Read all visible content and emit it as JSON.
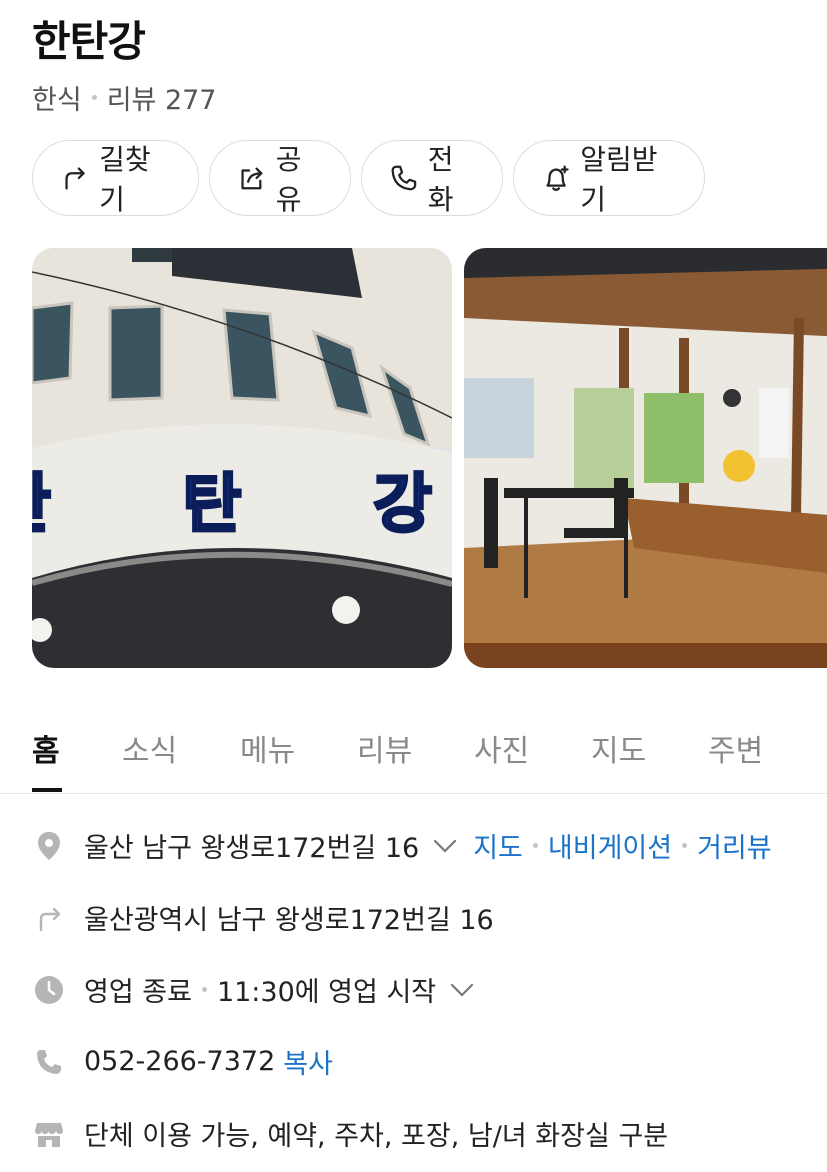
{
  "place": {
    "name": "한탄강",
    "category": "한식",
    "review_label": "리뷰 277"
  },
  "actions": {
    "route_label": "길찾기",
    "share_label": "공유",
    "call_label": "전화",
    "alarm_label": "알림받기"
  },
  "photos": {
    "sign_text": "한탄강"
  },
  "tabs": {
    "home": "홈",
    "news": "소식",
    "menu": "메뉴",
    "review": "리뷰",
    "photo": "사진",
    "map": "지도",
    "nearby": "주변"
  },
  "info": {
    "address": "울산 남구 왕생로172번길 16",
    "map_link": "지도",
    "navi_link": "내비게이션",
    "street_link": "거리뷰",
    "road_address": "울산광역시 남구 왕생로172번길 16",
    "status": "영업 종료",
    "hours": "11:30에 영업 시작",
    "phone": "052-266-7372",
    "copy_link": "복사",
    "amenities": "단체 이용 가능, 예약, 주차, 포장, 남/녀 화장실 구분"
  },
  "colors": {
    "link": "#1a73c9",
    "icon_gray": "#b5b5b5"
  },
  "icons": [
    "route-icon",
    "share-icon",
    "phone-icon",
    "bell-icon",
    "pin-icon",
    "road-arrow-icon",
    "clock-icon",
    "phone-icon",
    "store-icon"
  ]
}
